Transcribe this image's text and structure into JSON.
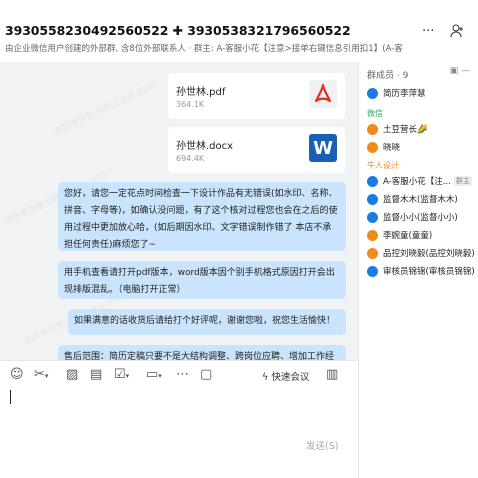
{
  "header": {
    "title": "3930558230492560522 ✚ 3930538321796560522",
    "subtitle": "由企业微信用户创建的外部群, 含8位外部联系人 · 群主: A-客服小花【注意>接单右键信息引用扣1】(A-客...",
    "more_icon": "more-dots-icon",
    "add_member_icon": "add-member-icon"
  },
  "messages": {
    "files": [
      {
        "name": "孙世林.pdf",
        "size": "364.1K",
        "icon": "pdf-icon"
      },
      {
        "name": "孙世林.docx",
        "size": "694.4K",
        "icon": "word-icon",
        "icon_letter": "W"
      }
    ],
    "bubbles": [
      {
        "text": "您好，请您一定花点时间检查一下设计作品有无错误(如水印、名称、拼音、字母等)，如确认没问题，有了这个核对过程您也会在之后的使用过程中更加放心哈，(如后期因水印、文字错误制作错了 本店不承担任何责任)麻烦您了~"
      },
      {
        "text": "用手机查看请打开pdf版本，word版本因个别手机格式原因打开会出现排版混乱。（电脑打开正常）"
      },
      {
        "text": "如果满意的话收货后请给打个好评呢，谢谢您啦，祝您生活愉快！"
      },
      {
        "text": "售后范围：简历定稿只要不是大结构调整、跨岗位应聘、增加工作经"
      }
    ],
    "watermark": "简历李萍慧 付款人设计 3930"
  },
  "composer": {
    "meeting_label": "快速会议",
    "send_label": "发送(S)"
  },
  "sidebar": {
    "header": "群成员 · 9",
    "members": [
      {
        "name": "简历李萍慧",
        "icon": "blue"
      },
      {
        "group": "微信"
      },
      {
        "name": "土豆营长🌽",
        "icon": "orange"
      },
      {
        "name": "晓晓",
        "icon": "orange"
      },
      {
        "group": "牛人设计"
      },
      {
        "name": "A-客服小花【注...",
        "icon": "blue",
        "badge": "群主"
      },
      {
        "name": "监督木木(监督木木)",
        "icon": "blue"
      },
      {
        "name": "监督小小(监督小小)",
        "icon": "blue"
      },
      {
        "name": "李婉童(童童)",
        "icon": "orange"
      },
      {
        "name": "品控刘晓毅(品控刘晓毅)",
        "icon": "orange"
      },
      {
        "name": "审核员锦锦(审核员锦锦)",
        "icon": "blue"
      }
    ],
    "colors": {
      "wechat": "#2aae67",
      "company": "#f08a1c"
    }
  }
}
